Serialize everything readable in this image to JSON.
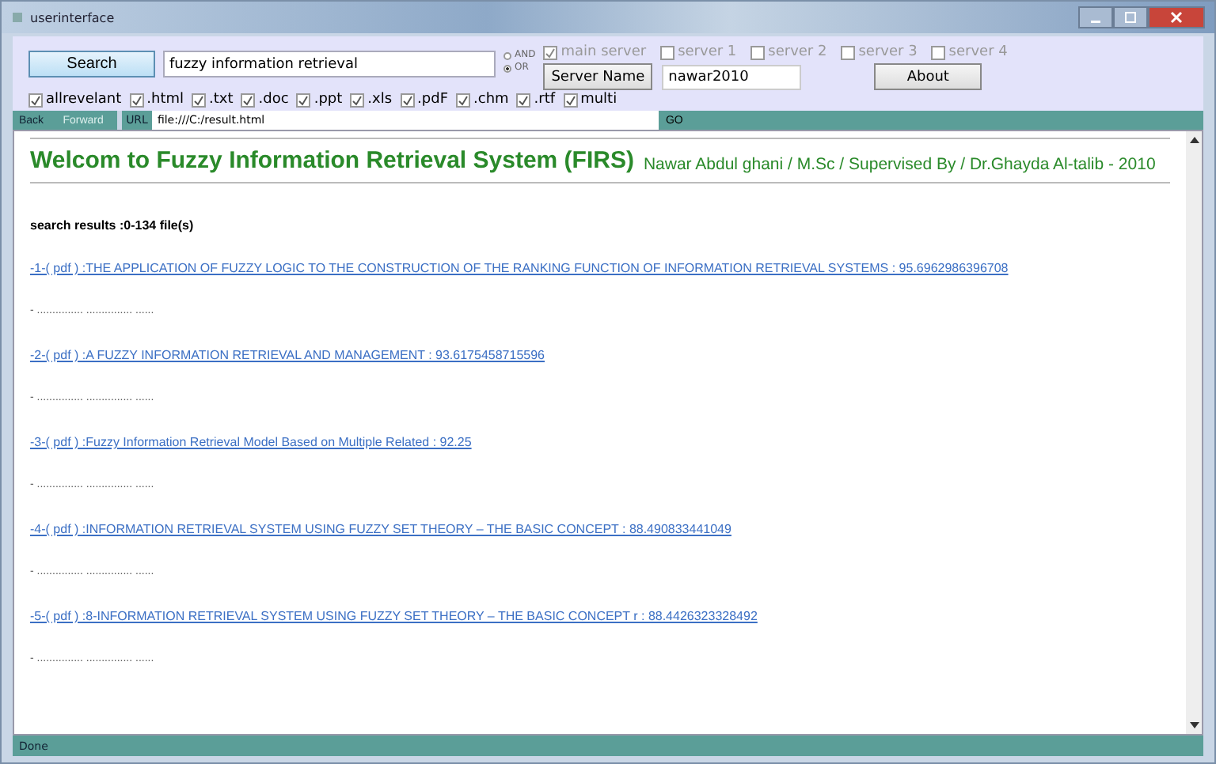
{
  "window": {
    "title": "userinterface"
  },
  "search_button": "Search",
  "query": "fuzzy information retrieval",
  "modes": [
    {
      "label": "AND",
      "selected": false
    },
    {
      "label": "OR",
      "selected": true
    }
  ],
  "servers": [
    {
      "label": "main server",
      "checked": true
    },
    {
      "label": "server 1",
      "checked": false
    },
    {
      "label": "server 2",
      "checked": false
    },
    {
      "label": "server 3",
      "checked": false
    },
    {
      "label": "server 4",
      "checked": false
    }
  ],
  "file_types": [
    {
      "label": "allrevelant",
      "checked": true
    },
    {
      "label": ".html",
      "checked": true
    },
    {
      "label": ".txt",
      "checked": true
    },
    {
      "label": ".doc",
      "checked": true
    },
    {
      "label": ".ppt",
      "checked": true
    },
    {
      "label": ".xls",
      "checked": true
    },
    {
      "label": ".pdF",
      "checked": true
    },
    {
      "label": ".chm",
      "checked": true
    },
    {
      "label": ".rtf",
      "checked": true
    },
    {
      "label": "multi",
      "checked": true
    }
  ],
  "server_name_button": "Server Name",
  "server_name": "nawar2010",
  "about_button": "About",
  "nav": {
    "back": {
      "label": "Back",
      "disabled": false
    },
    "forward": {
      "label": "Forward",
      "disabled": true
    },
    "url_label": "URL",
    "url": "file:///C:/result.html",
    "go": "GO"
  },
  "page": {
    "title": "Welcom to Fuzzy Information Retrieval System (FIRS)",
    "byline": "Nawar Abdul ghani / M.Sc / Supervised By / Dr.Ghayda Al-talib - 2010",
    "summary": "search results :0-134 file(s)",
    "results": [
      {
        "link": "-1-( pdf ) :THE APPLICATION OF FUZZY LOGIC TO THE CONSTRUCTION OF THE RANKING FUNCTION OF INFORMATION RETRIEVAL SYSTEMS : 95.6962986396708",
        "snippet": "- ............... ............... ......"
      },
      {
        "link": "-2-( pdf ) :A FUZZY INFORMATION RETRIEVAL AND MANAGEMENT : 93.6175458715596",
        "snippet": "- ............... ............... ......"
      },
      {
        "link": "-3-( pdf ) :Fuzzy Information Retrieval Model Based on Multiple Related : 92.25",
        "snippet": "- ............... ............... ......"
      },
      {
        "link": "-4-( pdf ) :INFORMATION RETRIEVAL SYSTEM USING FUZZY SET THEORY – THE BASIC CONCEPT : 88.490833441049",
        "snippet": "- ............... ............... ......"
      },
      {
        "link": "-5-( pdf ) :8-INFORMATION RETRIEVAL SYSTEM USING FUZZY SET THEORY – THE BASIC CONCEPT r : 88.4426323328492",
        "snippet": "- ............... ............... ......"
      }
    ]
  },
  "status_bar": "Done"
}
